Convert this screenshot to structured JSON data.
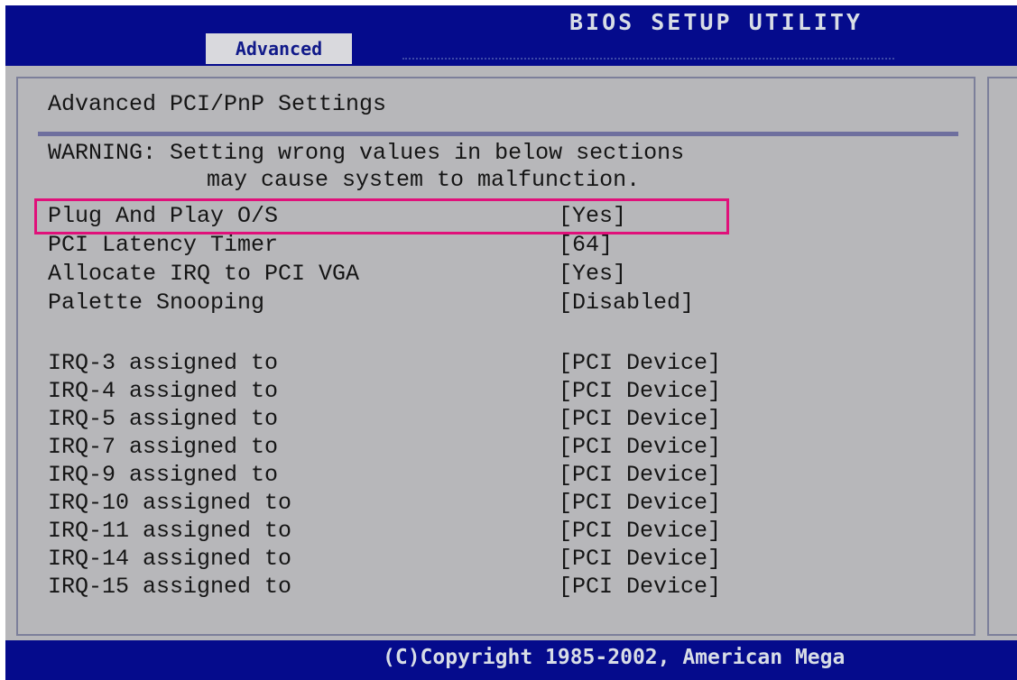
{
  "header": {
    "title": "BIOS SETUP UTILITY",
    "active_tab": "Advanced"
  },
  "page": {
    "heading": "Advanced PCI/PnP Settings",
    "warning_line1": "WARNING: Setting wrong values in below sections",
    "warning_line2": "may cause system to malfunction."
  },
  "settings": [
    {
      "label": "Plug And Play O/S",
      "value": "[Yes]",
      "highlighted": true
    },
    {
      "label": "PCI Latency Timer",
      "value": "[64]"
    },
    {
      "label": "Allocate IRQ to PCI VGA",
      "value": "[Yes]"
    },
    {
      "label": "Palette Snooping",
      "value": "[Disabled]"
    }
  ],
  "irq_settings": [
    {
      "label": "IRQ-3 assigned to",
      "value": "[PCI Device]"
    },
    {
      "label": "IRQ-4 assigned to",
      "value": "[PCI Device]"
    },
    {
      "label": "IRQ-5 assigned to",
      "value": "[PCI Device]"
    },
    {
      "label": "IRQ-7 assigned to",
      "value": "[PCI Device]"
    },
    {
      "label": "IRQ-9 assigned to",
      "value": "[PCI Device]"
    },
    {
      "label": "IRQ-10 assigned to",
      "value": "[PCI Device]"
    },
    {
      "label": "IRQ-11 assigned to",
      "value": "[PCI Device]"
    },
    {
      "label": "IRQ-14 assigned to",
      "value": "[PCI Device]"
    },
    {
      "label": "IRQ-15 assigned to",
      "value": "[PCI Device]"
    }
  ],
  "footer": {
    "copyright": "(C)Copyright 1985-2002, American Mega"
  },
  "colors": {
    "header_bg": "#050b8c",
    "panel_bg": "#b7b7ba",
    "highlight_border": "#e0107a"
  }
}
